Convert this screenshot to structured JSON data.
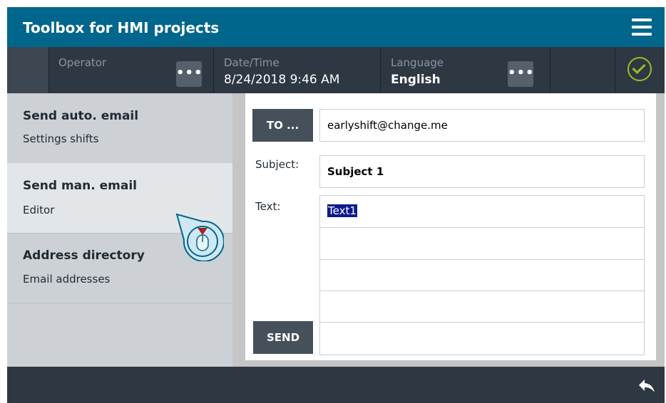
{
  "header": {
    "title": "Toolbox for HMI projects",
    "menu_icon": "hamburger-menu-icon"
  },
  "statusbar": {
    "operator_label": "Operator",
    "operator_more": "•••",
    "datetime_label": "Date/Time",
    "datetime_value": "8/24/2018 9:46 AM",
    "language_label": "Language",
    "language_value": "English",
    "language_more": "•••",
    "status_icon": "check-circle-icon",
    "status_color": "#9bbd2a"
  },
  "sidebar": {
    "items": [
      {
        "title": "Send auto. email",
        "subtitle": "Settings shifts",
        "active": false
      },
      {
        "title": "Send man. email",
        "subtitle": "Editor",
        "active": true
      },
      {
        "title": "Address directory",
        "subtitle": "Email addresses",
        "active": false
      }
    ]
  },
  "email_form": {
    "to_button": "TO ...",
    "to_value": "earlyshift@change.me",
    "subject_label": "Subject:",
    "subject_value": "Subject 1",
    "text_label": "Text:",
    "text_value": "Text1",
    "send_button": "SEND"
  },
  "footer": {
    "back_icon": "back-arrow-icon"
  },
  "colors": {
    "title_bar": "#00668c",
    "dark_bar": "#2d3843",
    "selection": "#0d1a8c",
    "button": "#45505a"
  }
}
